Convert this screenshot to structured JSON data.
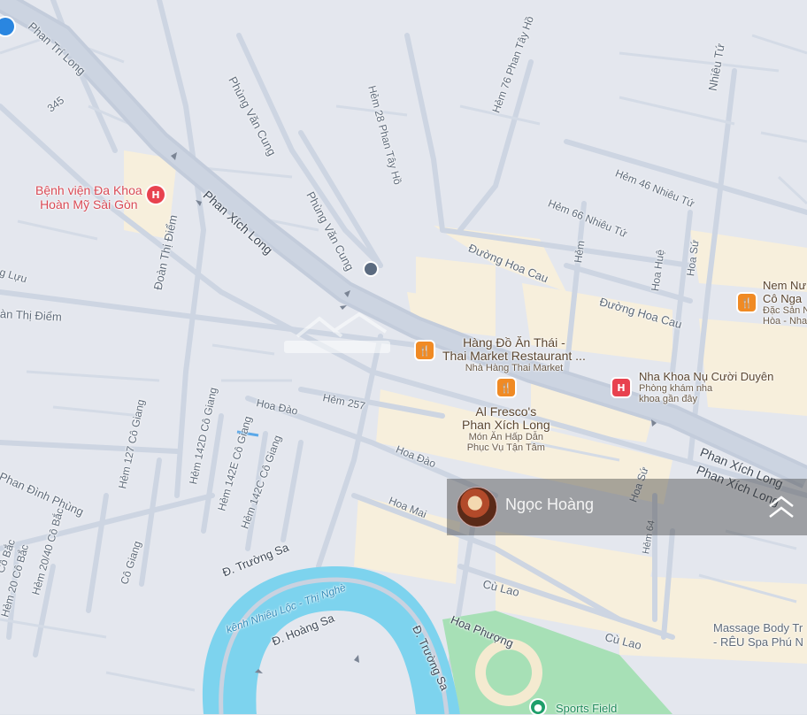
{
  "labels": {
    "phan_tri_long": "Phan Trí Long",
    "num_345": "345",
    "phung_van_cung_1": "Phùng Văn Cung",
    "phung_van_cung_2": "Phùng Văn Cung",
    "hem_28_phan_tay_ho": "Hẻm 28 Phan Tây Hồ",
    "hem_76_phan_tay_ho": "Hẻm 76 Phan Tây Hồ",
    "nhieu_tu": "Nhiêu Tứ",
    "hem_46_nhieu_tu": "Hẻm 46 Nhiêu Tứ",
    "hem_66_nhieu_tu": "Hẻm 66 Nhiêu Tứ",
    "duong_hoa_cau_1": "Đường Hoa Cau",
    "duong_hoa_cau_2": "Đường Hoa Cau",
    "hem": "Hẻm",
    "hoa_hue": "Hoa Huệ",
    "hoa_su_1": "Hoa Sứ",
    "phan_xich_long_1": "Phan Xích Long",
    "phan_xich_long_2": "Phan Xích Long",
    "phan_xich_long_3": "Phan Xích Long",
    "doan_thi_diem_1": "Đoàn Thị Điểm",
    "doan_thi_diem_2": "àn Thị Điểm",
    "luu": "g Lựu",
    "hem_257": "Hẻm 257",
    "hoa_dao_1": "Hoa Đào",
    "hoa_dao_2": "Hoa Đào",
    "hoa_mai": "Hoa Mai",
    "hoa_su_2": "Hoa Sứ",
    "hem_64": "Hẻm 64",
    "hem_142d": "Hẻm 142D Cô Giang",
    "hem_142e": "Hẻm 142E Cô Giang",
    "hem_142c": "Hẻm 142C Cô Giang",
    "hem_127": "Hẻm 127 Cô Giang",
    "co_giang": "Cô Giang",
    "phan_dinh_phung": "Phan Đình Phùng",
    "hem_20_40": "Hẻm 20/40 Cô Bắc",
    "hem_20_co_bac": "Hẻm 20 Cô Bắc",
    "co_bac": "Cô Bắc",
    "truong_sa_1": "Đ. Trường Sa",
    "truong_sa_2": "Đ. Trường Sa",
    "hoang_sa": "Đ. Hoàng Sa",
    "kenh": "kênh Nhiêu Lộc - Thị Nghè",
    "cu_lao_1": "Cù Lao",
    "cu_lao_2": "Cù Lao",
    "hoa_phuong": "Hoa Phượng"
  },
  "pois": {
    "hospital_name_1": "Bệnh viện Đa Khoa",
    "hospital_name_2": "Hoàn Mỹ Sài Gòn",
    "thai_1": "Hàng Đồ Ăn Thái -",
    "thai_2": "Thai Market Restaurant ...",
    "thai_sub": "Nhà Hàng Thai Market",
    "alfresco_1": "Al Fresco's",
    "alfresco_2": "Phan Xích Long",
    "alfresco_sub_1": "Món Ăn Hấp Dẫn",
    "alfresco_sub_2": "Phục Vụ Tận Tâm",
    "nhakhoa": "Nha Khoa Nụ Cười Duyên",
    "nhakhoa_sub_1": "Phòng khám nha",
    "nhakhoa_sub_2": "khoa gần đây",
    "nem_1": "Nem Nư",
    "nem_2": "Cô Nga",
    "nem_sub_1": "Đặc Sản N",
    "nem_sub_2": "Hòa - Nha",
    "massage_1": "Massage Body Tr",
    "massage_2": "- RÊU Spa Phú N",
    "sports": "Sports Field"
  },
  "overlay": {
    "username": "Ngọc Hoàng"
  },
  "icons": {
    "hospital": "hospital-icon",
    "restaurant": "restaurant-icon",
    "bus": "bus-stop-icon",
    "park": "park-pin-icon",
    "lock": "lock-icon",
    "expand": "double-chevron-up-icon"
  },
  "colors": {
    "road": "#c9d2e0",
    "block": "#e6e8ef",
    "commercial": "#f6eedb",
    "water": "#7dd3ee",
    "park": "#a6e0b5",
    "hospital": "#e8424f",
    "restaurant": "#f08a24"
  }
}
